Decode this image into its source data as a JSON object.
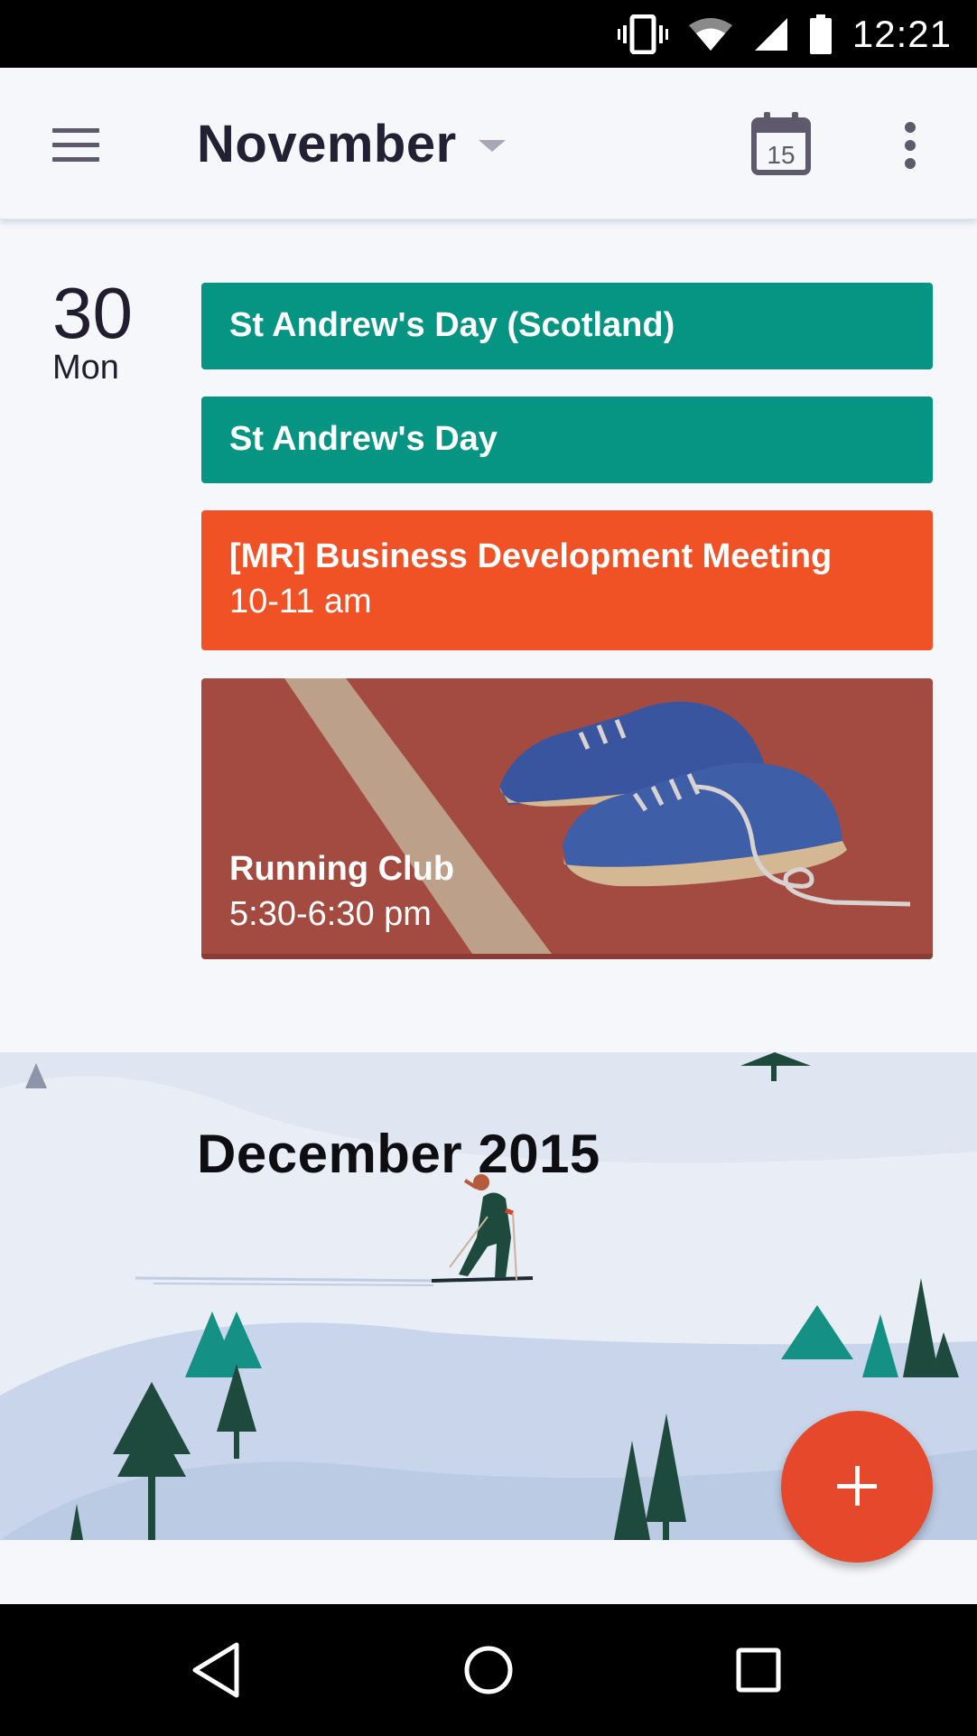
{
  "status_bar": {
    "time": "12:21",
    "icons": [
      "vibrate-icon",
      "wifi-icon",
      "signal-icon",
      "battery-icon"
    ]
  },
  "app_bar": {
    "title": "November",
    "today_icon_day": "15",
    "icons": [
      "menu-icon",
      "dropdown-icon",
      "today-calendar-icon",
      "more-vert-icon"
    ]
  },
  "day": {
    "number": "30",
    "weekday": "Mon"
  },
  "events": [
    {
      "title": "St Andrew's Day (Scotland)",
      "time": "",
      "color": "#069483"
    },
    {
      "title": "St Andrew's Day",
      "time": "",
      "color": "#069483"
    },
    {
      "title": "[MR] Business Development Meeting",
      "time": "10-11 am",
      "color": "#f05225"
    },
    {
      "title": "Running Club",
      "time": "5:30-6:30 pm",
      "color": "#a44b41",
      "illustration": "running-shoes"
    }
  ],
  "month_banner": {
    "title": "December 2015",
    "illustration": "winter-skier"
  },
  "fab": {
    "icon": "plus-icon",
    "color": "#e5482a"
  },
  "nav_bar": {
    "icons": [
      "back-icon",
      "home-icon",
      "recents-icon"
    ]
  }
}
